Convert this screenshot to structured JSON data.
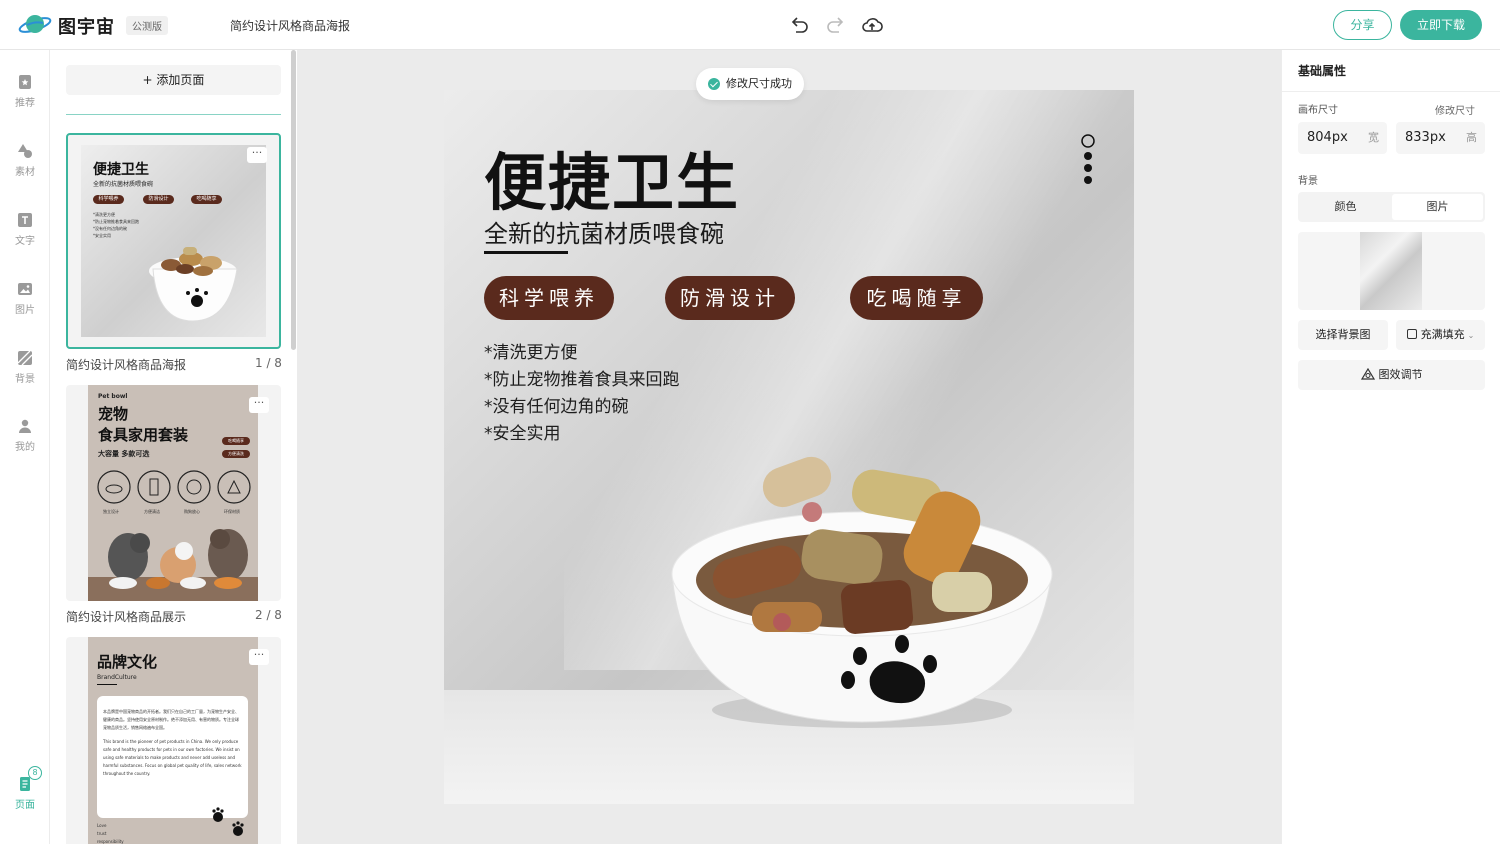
{
  "app": {
    "name": "图宇宙",
    "beta_label": "公测版",
    "doc_title": "简约设计风格商品海报"
  },
  "topbar": {
    "share_label": "分享",
    "download_label": "立即下载"
  },
  "rail": {
    "items": [
      {
        "label": "推荐",
        "icon": "recommend-icon"
      },
      {
        "label": "素材",
        "icon": "shapes-icon"
      },
      {
        "label": "文字",
        "icon": "text-icon"
      },
      {
        "label": "图片",
        "icon": "image-icon"
      },
      {
        "label": "背景",
        "icon": "background-icon"
      },
      {
        "label": "我的",
        "icon": "user-icon"
      },
      {
        "label": "页面",
        "icon": "pages-icon",
        "badge": "8"
      }
    ]
  },
  "pages_panel": {
    "add_page_label": "添加页面",
    "thumbs": [
      {
        "caption": "简约设计风格商品海报",
        "index": "1 / 8",
        "active": true,
        "title": "便捷卫生",
        "subtitle": "全新的抗菌材质喂食碗",
        "tags": [
          "科学喂养",
          "防滑设计",
          "吃喝随享"
        ],
        "features": [
          "*清洗更方便",
          "*防止宠物推着食具来回跑",
          "*没有任何边角的碗",
          "*安全实用"
        ]
      },
      {
        "caption": "简约设计风格商品展示",
        "index": "2 / 8",
        "eyebrow": "Pet bowl",
        "title_line1": "宠物",
        "title_line2": "食具家用套装",
        "subtitle": "大容量 多款可选",
        "tags": [
          "吃喝随享",
          "方便清洗"
        ],
        "icon_labels": [
          "独立设计",
          "方便清洁",
          "购狗放心",
          "环保材质"
        ]
      },
      {
        "title": "品牌文化",
        "subtitle": "BrandCulture",
        "cn_text": "本品牌是中国宠物商品的开拓者。我们只在自己的工厂量，为宠物生产安全、健康的商品。坚持使用安全原材制作。绝不添加无用、有害的物质。专注全球宠物品质生活，销售网络遍布全国。",
        "en_text": "This brand is the pioneer of pet products in China. We only produce safe and healthy products for pets in our own factories. We insist on using safe materials to make products and never add useless and harmful substances. Focus on global pet quality of life, sales network throughout the country.",
        "footer": [
          "Love",
          "trust",
          "responsibility"
        ]
      }
    ]
  },
  "toast": {
    "text": "修改尺寸成功"
  },
  "poster": {
    "title": "便捷卫生",
    "subtitle": "全新的抗菌材质喂食碗",
    "tags": [
      "科学喂养",
      "防滑设计",
      "吃喝随享"
    ],
    "features": [
      "*清洗更方便",
      "*防止宠物推着食具来回跑",
      "*没有任何边角的碗",
      "*安全实用"
    ],
    "brand_color": "#5a2a1d"
  },
  "props": {
    "section_title": "基础属性",
    "canvas_size_label": "画布尺寸",
    "edit_size_label": "修改尺寸",
    "width_value": "804px",
    "width_unit": "宽",
    "height_value": "833px",
    "height_unit": "高",
    "background_label": "背景",
    "tabs": [
      "颜色",
      "图片"
    ],
    "active_tab": "图片",
    "choose_bg_label": "选择背景图",
    "fill_mode_label": "充满填充",
    "effects_label": "图效调节"
  },
  "colors": {
    "accent": "#3bb59e",
    "tag_brown": "#5a2a1d"
  }
}
